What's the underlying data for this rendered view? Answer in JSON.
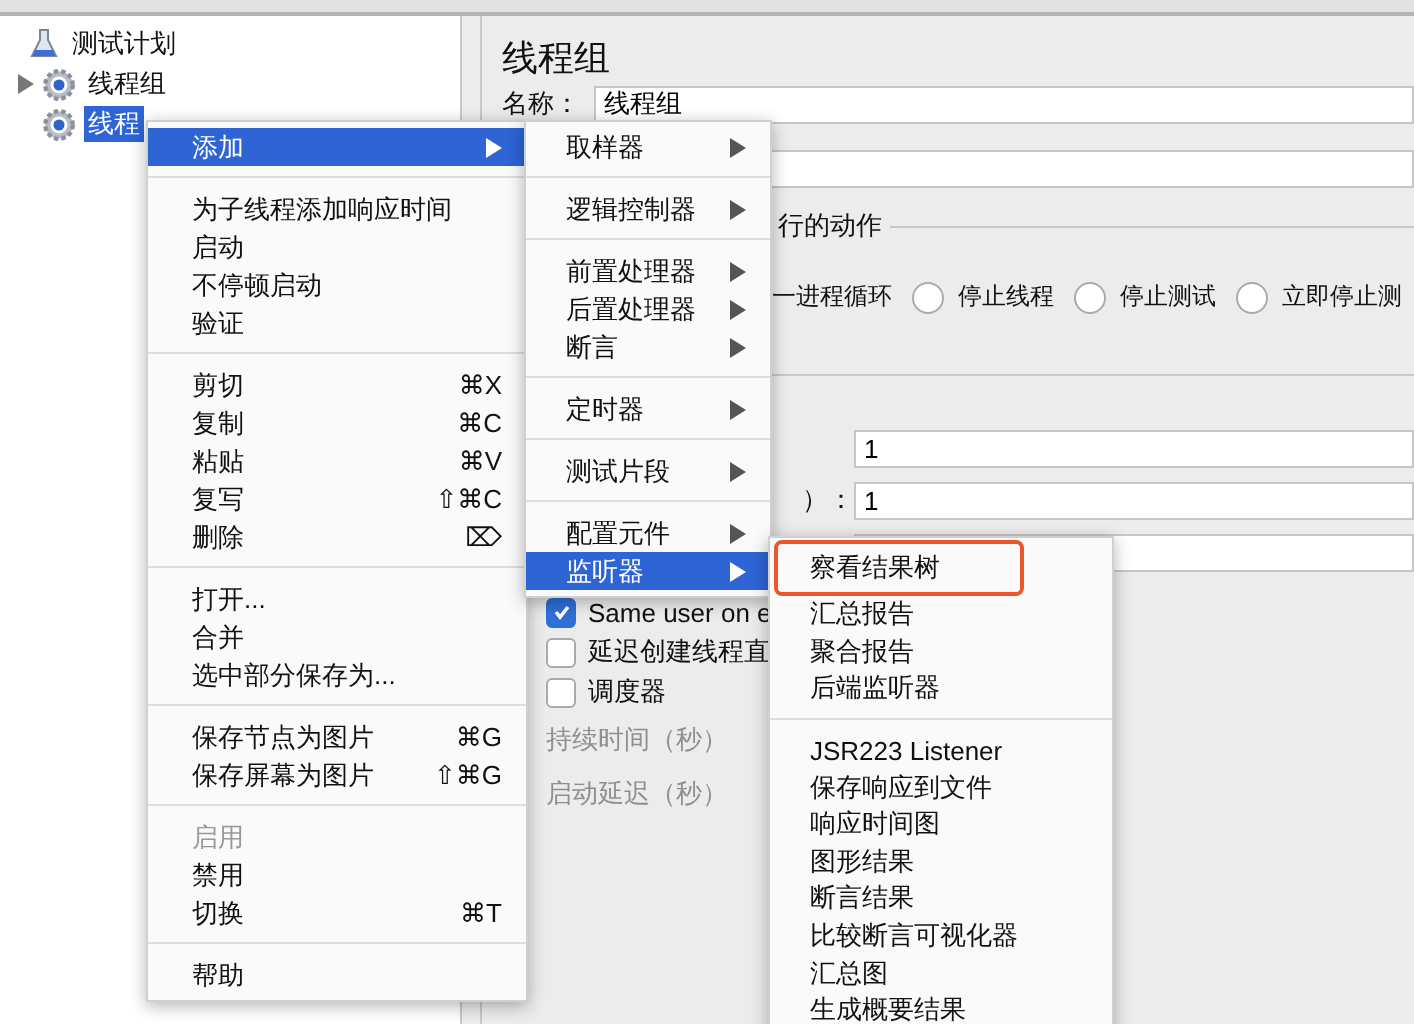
{
  "tree": [
    {
      "label": "测试计划",
      "kind": "plan",
      "collapsed": false,
      "selected": false,
      "children": [
        {
          "label": "线程组",
          "kind": "group",
          "collapsed": true,
          "selected": false
        },
        {
          "label": "线程",
          "kind": "group",
          "collapsed": false,
          "selected": true
        }
      ]
    }
  ],
  "panel": {
    "title": "线程组",
    "name_label": "名称：",
    "name_value": "线程组",
    "action_legend": "行的动作",
    "radios": [
      {
        "label": "一进程循环"
      },
      {
        "label": "停止线程",
        "selected": false
      },
      {
        "label": "停止测试",
        "selected": false
      },
      {
        "label": "立即停止测",
        "selected": false
      }
    ],
    "fields": [
      {
        "value": "1"
      },
      {
        "label": "）：",
        "value": "1"
      }
    ],
    "checkboxes": [
      {
        "label": "Same user on e",
        "checked": true
      },
      {
        "label": "延迟创建线程直",
        "checked": false
      },
      {
        "label": "调度器",
        "checked": false
      }
    ],
    "disabled_labels": [
      "持续时间（秒）",
      "启动延迟（秒）"
    ]
  },
  "context_menu": {
    "groups": [
      [
        {
          "label": "添加",
          "submenu": true,
          "selected": true,
          "disabled": false
        }
      ],
      [
        {
          "label": "为子线程添加响应时间",
          "submenu": false,
          "selected": false,
          "disabled": false
        },
        {
          "label": "启动",
          "submenu": false,
          "selected": false,
          "disabled": false
        },
        {
          "label": "不停顿启动",
          "submenu": false,
          "selected": false,
          "disabled": false
        },
        {
          "label": "验证",
          "submenu": false,
          "selected": false,
          "disabled": false
        }
      ],
      [
        {
          "label": "剪切",
          "shortcut": "⌘X",
          "submenu": false,
          "selected": false,
          "disabled": false
        },
        {
          "label": "复制",
          "shortcut": "⌘C",
          "submenu": false,
          "selected": false,
          "disabled": false
        },
        {
          "label": "粘贴",
          "shortcut": "⌘V",
          "submenu": false,
          "selected": false,
          "disabled": false
        },
        {
          "label": "复写",
          "shortcut": "⇧⌘C",
          "submenu": false,
          "selected": false,
          "disabled": false
        },
        {
          "label": "删除",
          "shortcut": "⌦",
          "submenu": false,
          "selected": false,
          "disabled": false
        }
      ],
      [
        {
          "label": "打开...",
          "submenu": false,
          "selected": false,
          "disabled": false
        },
        {
          "label": "合并",
          "submenu": false,
          "selected": false,
          "disabled": false
        },
        {
          "label": "选中部分保存为...",
          "submenu": false,
          "selected": false,
          "disabled": false
        }
      ],
      [
        {
          "label": "保存节点为图片",
          "shortcut": "⌘G",
          "submenu": false,
          "selected": false,
          "disabled": false
        },
        {
          "label": "保存屏幕为图片",
          "shortcut": "⇧⌘G",
          "submenu": false,
          "selected": false,
          "disabled": false
        }
      ],
      [
        {
          "label": "启用",
          "submenu": false,
          "selected": false,
          "disabled": true
        },
        {
          "label": "禁用",
          "submenu": false,
          "selected": false,
          "disabled": false
        },
        {
          "label": "切换",
          "shortcut": "⌘T",
          "submenu": false,
          "selected": false,
          "disabled": false
        }
      ],
      [
        {
          "label": "帮助",
          "submenu": false,
          "selected": false,
          "disabled": false
        }
      ]
    ]
  },
  "add_submenu": {
    "groups": [
      [
        {
          "label": "取样器",
          "submenu": true,
          "selected": false
        }
      ],
      [
        {
          "label": "逻辑控制器",
          "submenu": true,
          "selected": false
        }
      ],
      [
        {
          "label": "前置处理器",
          "submenu": true,
          "selected": false
        },
        {
          "label": "后置处理器",
          "submenu": true,
          "selected": false
        },
        {
          "label": "断言",
          "submenu": true,
          "selected": false
        }
      ],
      [
        {
          "label": "定时器",
          "submenu": true,
          "selected": false
        }
      ],
      [
        {
          "label": "测试片段",
          "submenu": true,
          "selected": false
        }
      ],
      [
        {
          "label": "配置元件",
          "submenu": true,
          "selected": false
        },
        {
          "label": "监听器",
          "submenu": true,
          "selected": true
        }
      ]
    ]
  },
  "listener_submenu": {
    "groups": [
      [
        {
          "label": "察看结果树",
          "highlighted": true
        },
        {
          "label": "汇总报告",
          "highlighted": false
        },
        {
          "label": "聚合报告",
          "highlighted": false
        },
        {
          "label": "后端监听器",
          "highlighted": false
        }
      ],
      [
        {
          "label": "JSR223 Listener",
          "highlighted": false
        },
        {
          "label": "保存响应到文件",
          "highlighted": false
        },
        {
          "label": "响应时间图",
          "highlighted": false
        },
        {
          "label": "图形结果",
          "highlighted": false
        },
        {
          "label": "断言结果",
          "highlighted": false
        },
        {
          "label": "比较断言可视化器",
          "highlighted": false
        },
        {
          "label": "汇总图",
          "highlighted": false
        },
        {
          "label": "生成概要结果",
          "highlighted": false
        }
      ]
    ]
  }
}
